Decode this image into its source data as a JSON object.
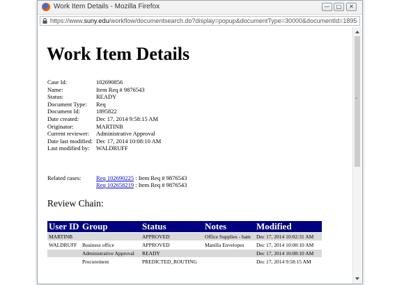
{
  "window": {
    "title": "Work Item Details - Mozilla Firefox",
    "url_prefix": "https://www.",
    "url_domain": "suny.edu",
    "url_rest": "/workflow/documentsearch.do?display=popup&documentType=30000&documentId=1895"
  },
  "page": {
    "title": "Work Item Details",
    "details": [
      {
        "label": "Case Id:",
        "value": "102690856"
      },
      {
        "label": "Name:",
        "value": "Item Req # 9876543"
      },
      {
        "label": "Status:",
        "value": "READY"
      },
      {
        "label": "Document Type:",
        "value": "Req"
      },
      {
        "label": "Document Id:",
        "value": "1895822"
      },
      {
        "label": "Date created:",
        "value": "Dec 17, 2014 9:58:15 AM"
      },
      {
        "label": "Originator:",
        "value": "MARTINB"
      },
      {
        "label": "Current reviewer:",
        "value": "Administrative Approval"
      },
      {
        "label": "Date last modified:",
        "value": "Dec 17, 2014 10:08:10 AM"
      },
      {
        "label": "Last modified by:",
        "value": "WALDRUFF"
      }
    ],
    "related_label": "Related cases:",
    "related": [
      {
        "link": "Req 102690225",
        "text": " : Item Req # 9876543"
      },
      {
        "link": "Req 102658219",
        "text": " : Item Req # 9876543"
      }
    ],
    "review_title": "Review Chain:",
    "review_headers": [
      "User ID",
      "Group",
      "Status",
      "Notes",
      "Modified"
    ],
    "review_rows": [
      [
        "MARTINB",
        "",
        "APPROVED",
        "Office Supplies - bam",
        "Dec 17, 2014 10:02:31 AM"
      ],
      [
        "WALDRUFF",
        "Business office",
        "APPROVED",
        "Manilla Envelopes",
        "Dec 17, 2014 10:08:10 AM"
      ],
      [
        "",
        "Administrative Approval",
        "READY",
        "",
        "Dec 17, 2014 10:08:10 AM"
      ],
      [
        "",
        "Procurement",
        "PREDICTED_ROUTING",
        "",
        "Dec 17, 2014 9:58:15 AM"
      ]
    ]
  }
}
